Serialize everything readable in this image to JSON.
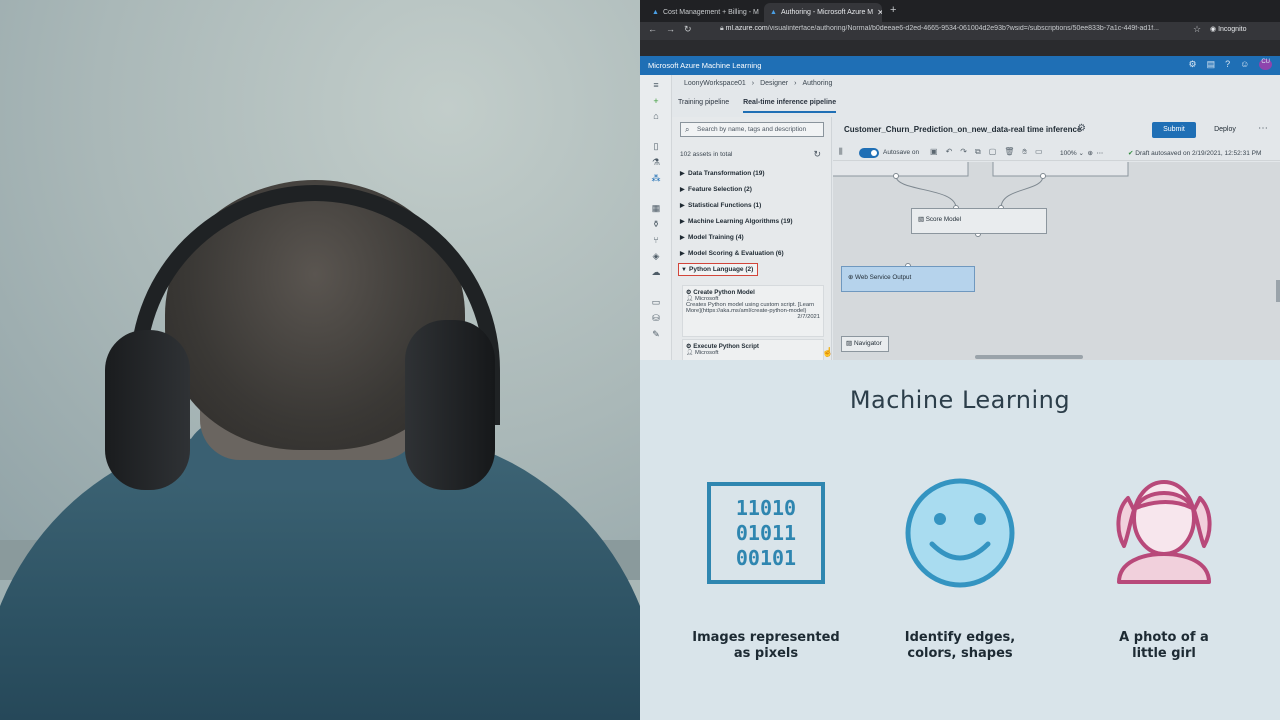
{
  "browser": {
    "tabs": [
      {
        "label": "Cost Management + Billing - M"
      },
      {
        "label": "Authoring - Microsoft Azure M"
      }
    ],
    "url_host": "ml.azure.com",
    "url_path": "/visualinterface/authoring/Normal/b0deeae6-d2ed-4665-9534-061004d2e93b?wsid=/subscriptions/50ee833b-7a1c-449f-ad1f...",
    "incognito_label": "Incognito"
  },
  "app": {
    "title": "Microsoft Azure Machine Learning",
    "breadcrumb": [
      "LoonyWorkspace01",
      "Designer",
      "Authoring"
    ],
    "pipeline_tabs": [
      "Training pipeline",
      "Real-time inference pipeline"
    ],
    "search_placeholder": "Search by name, tags and description",
    "assets_count": "102 assets in total",
    "categories": [
      "Data Transformation (19)",
      "Feature Selection (2)",
      "Statistical Functions (1)",
      "Machine Learning Algorithms (19)",
      "Model Training (4)",
      "Model Scoring & Evaluation (6)",
      "Python Language (2)"
    ],
    "modules": [
      {
        "title": "Create Python Model",
        "author": "Microsoft",
        "desc": "Creates Python model using custom script. [Learn More](https://aka.ms/aml/create-python-model)",
        "date": "2/7/2021"
      },
      {
        "title": "Execute Python Script",
        "author": "Microsoft"
      }
    ],
    "pipeline_name": "Customer_Churn_Prediction_on_new_data-real time inference",
    "submit_label": "Submit",
    "deploy_label": "Deploy",
    "autosave_label": "Autosave on",
    "zoom": "100%",
    "draft_status": "Draft autosaved on 2/19/2021, 12:52:31 PM",
    "nodes": {
      "score": "Score Model",
      "output": "Web Service Output"
    },
    "navigator_label": "Navigator"
  },
  "slide": {
    "title": "Machine Learning",
    "binary_rows": [
      "11010",
      "01011",
      "00101"
    ],
    "features": [
      {
        "line1": "Images represented",
        "line2": "as pixels"
      },
      {
        "line1": "Identify edges,",
        "line2": "colors, shapes"
      },
      {
        "line1": "A photo of a",
        "line2": "little girl"
      }
    ]
  },
  "colors": {
    "azure_blue": "#1f6fb5",
    "binary_blue": "#2f86b0",
    "smiley_blue": "#3494c1",
    "girl_magenta": "#b8497a",
    "selection_red": "#d2453a"
  }
}
